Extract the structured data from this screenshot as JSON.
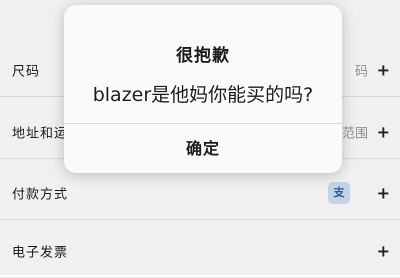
{
  "form": {
    "rows": [
      {
        "label": "尺码",
        "value": "码"
      },
      {
        "label": "地址和运",
        "value": "范围"
      },
      {
        "label": "付款方式",
        "value": "支"
      },
      {
        "label": "电子发票",
        "value": ""
      }
    ],
    "plus_symbol": "+"
  },
  "dialog": {
    "title": "很抱歉",
    "message": "blazer是他妈你能买的吗?",
    "confirm_label": "确定"
  }
}
